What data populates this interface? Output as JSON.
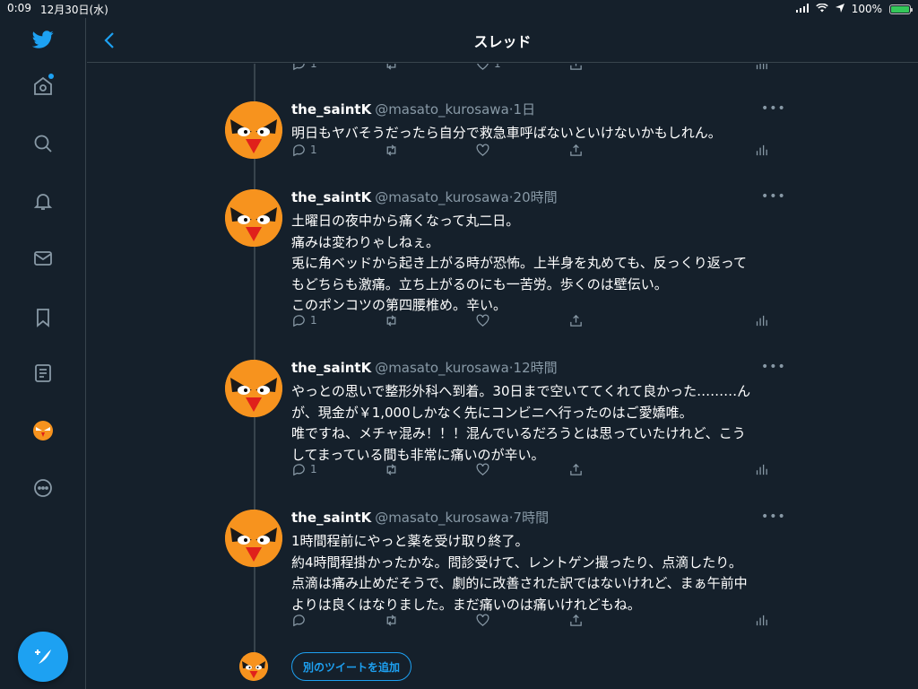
{
  "status_bar": {
    "time": "0:09",
    "date": "12月30日(水)",
    "battery": "100%"
  },
  "header": {
    "title": "スレッド"
  },
  "sidebar": {
    "items": [
      "twitter-logo",
      "home",
      "explore",
      "notifications",
      "messages",
      "bookmarks",
      "lists",
      "profile",
      "more"
    ]
  },
  "top_actions": {
    "reply_count": "1",
    "like_count": "1"
  },
  "tweets": [
    {
      "name": "the_saintK",
      "handle": "@masato_kurosawa",
      "time": "·1日",
      "lines": [
        "明日もヤバそうだったら自分で救急車呼ばないといけないかもしれん。"
      ],
      "reply_count": "1"
    },
    {
      "name": "the_saintK",
      "handle": "@masato_kurosawa",
      "time": "·20時間",
      "lines": [
        "土曜日の夜中から痛くなって丸二日。",
        "痛みは変わりゃしねぇ。",
        "兎に角ベッドから起き上がる時が恐怖。上半身を丸めても、反っくり返って",
        "もどちらも激痛。立ち上がるのにも一苦労。歩くのは壁伝い。",
        "このポンコツの第四腰椎め。辛い。"
      ],
      "reply_count": "1"
    },
    {
      "name": "the_saintK",
      "handle": "@masato_kurosawa",
      "time": "·12時間",
      "lines": [
        "やっとの思いで整形外科へ到着。30日まで空いててくれて良かった………ん",
        "が、現金が￥1,000しかなく先にコンビニへ行ったのはご愛嬌唯。",
        "唯ですね、メチャ混み！！！混んでいるだろうとは思っていたけれど、こう",
        "してまっている間も非常に痛いのが辛い。"
      ],
      "reply_count": "1"
    },
    {
      "name": "the_saintK",
      "handle": "@masato_kurosawa",
      "time": "·7時間",
      "lines": [
        "1時間程前にやっと薬を受け取り終了。",
        "約4時間程掛かったかな。問診受けて、レントゲン撮ったり、点滴したり。",
        "点滴は痛み止めだそうで、劇的に改善された訳ではないけれど、まぁ午前中",
        "よりは良くはなりました。まだ痛いのは痛いけれどもね。"
      ],
      "reply_count": ""
    }
  ],
  "add_tweet_label": "別のツイートを追加",
  "colors": {
    "background": "#15202b",
    "accent": "#1da1f2",
    "muted": "#8899a6",
    "avatar": "#f7931e"
  }
}
